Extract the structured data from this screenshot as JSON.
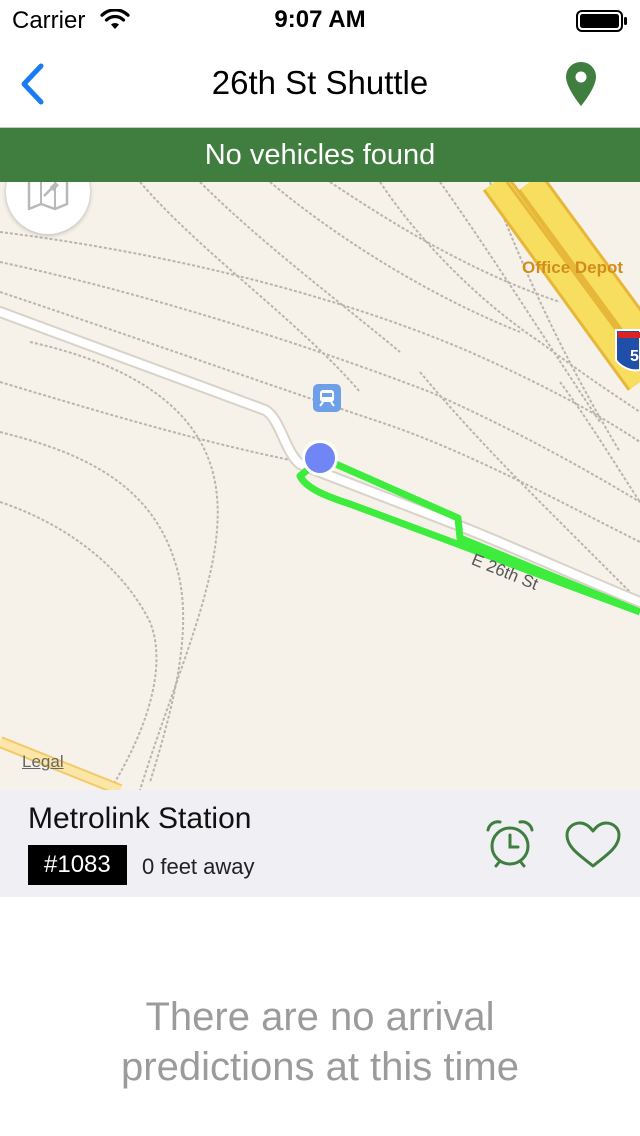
{
  "status_bar": {
    "carrier": "Carrier",
    "time": "9:07 AM",
    "icons": [
      "wifi-icon",
      "battery-icon"
    ]
  },
  "nav": {
    "title": "26th St Shuttle",
    "back_icon": "chevron-left-icon",
    "right_icon": "location-pin-icon"
  },
  "banner": {
    "text": "No vehicles found"
  },
  "map": {
    "poi_label": "Office Depot",
    "highway_shield": "5",
    "street_label": "E 26th St",
    "legal": "Legal",
    "toggle_icon": "map-satellite-icon",
    "stop_marker_icon": "train-icon"
  },
  "stop": {
    "name": "Metrolink Station",
    "id": "#1083",
    "distance": "0 feet away",
    "alarm_icon": "alarm-clock-icon",
    "favorite_icon": "heart-icon"
  },
  "arrivals": {
    "empty_message": "There are no arrival predictions at this time"
  },
  "colors": {
    "accent_green": "#3f7e3f",
    "route_green": "#3dec3d",
    "ios_blue": "#1a7cf5",
    "stop_marker": "#6f86f4"
  }
}
